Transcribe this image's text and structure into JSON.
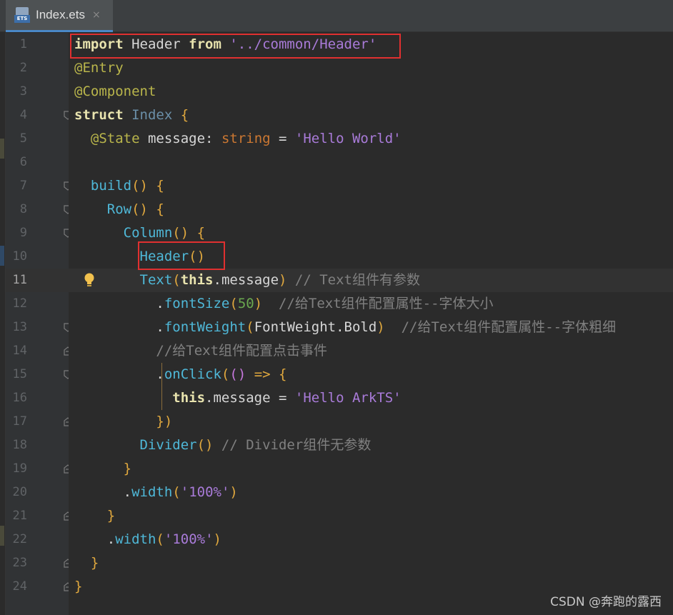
{
  "tab": {
    "title": "Index.ets",
    "icon": "ets-file-icon",
    "close": "×",
    "icon_label": "ETS"
  },
  "current_line": 11,
  "lines": [
    {
      "n": "1"
    },
    {
      "n": "2"
    },
    {
      "n": "3"
    },
    {
      "n": "4"
    },
    {
      "n": "5"
    },
    {
      "n": "6"
    },
    {
      "n": "7"
    },
    {
      "n": "8"
    },
    {
      "n": "9"
    },
    {
      "n": "10"
    },
    {
      "n": "11"
    },
    {
      "n": "12"
    },
    {
      "n": "13"
    },
    {
      "n": "14"
    },
    {
      "n": "15"
    },
    {
      "n": "16"
    },
    {
      "n": "17"
    },
    {
      "n": "18"
    },
    {
      "n": "19"
    },
    {
      "n": "20"
    },
    {
      "n": "21"
    },
    {
      "n": "22"
    },
    {
      "n": "23"
    },
    {
      "n": "24"
    }
  ],
  "code": {
    "l1": [
      "import",
      " Header ",
      "from",
      " '../common/Header'"
    ],
    "l2": "@Entry",
    "l3": "@Component",
    "l4": [
      "struct",
      " ",
      "Index",
      " {"
    ],
    "l5": [
      "@State",
      " message",
      ": ",
      "string",
      " = ",
      "'Hello World'"
    ],
    "l7": [
      "build",
      "()",
      " {"
    ],
    "l8": [
      "Row",
      "()",
      " {"
    ],
    "l9": [
      "Column",
      "()",
      " {"
    ],
    "l10": [
      "Header",
      "()"
    ],
    "l11": [
      "Text",
      "(",
      "this",
      ".message",
      ")",
      " // Text组件有参数"
    ],
    "l12": [
      ".",
      "fontSize",
      "(",
      "50",
      ")",
      "  //给Text组件配置属性--字体大小"
    ],
    "l13": [
      ".",
      "fontWeight",
      "(",
      "FontWeight.Bold",
      ")",
      "  //给Text组件配置属性--字体粗细"
    ],
    "l14": "//给Text组件配置点击事件",
    "l15": [
      ".",
      "onClick",
      "(",
      "()",
      " => {"
    ],
    "l16": [
      "this",
      ".message",
      " = ",
      "'Hello ArkTS'"
    ],
    "l17": [
      "}",
      ")"
    ],
    "l18": [
      "Divider",
      "()",
      " // Divider组件无参数"
    ],
    "l19": "}",
    "l20": [
      ".",
      "width",
      "(",
      "'100%'",
      ")"
    ],
    "l21": "}",
    "l22": [
      ".",
      "width",
      "(",
      "'100%'",
      ")"
    ],
    "l23": "}",
    "l24": "}"
  },
  "highlights": [
    {
      "label": "import-statement-highlight"
    },
    {
      "label": "header-call-highlight"
    }
  ],
  "watermark": "CSDN @奔跑的露西",
  "colors": {
    "background": "#2b2b2b",
    "gutter": "#313335",
    "highlight_box": "#e03030",
    "keyword": "#e8e3ae",
    "string": "#a97bd9",
    "function": "#4fb8d8"
  }
}
